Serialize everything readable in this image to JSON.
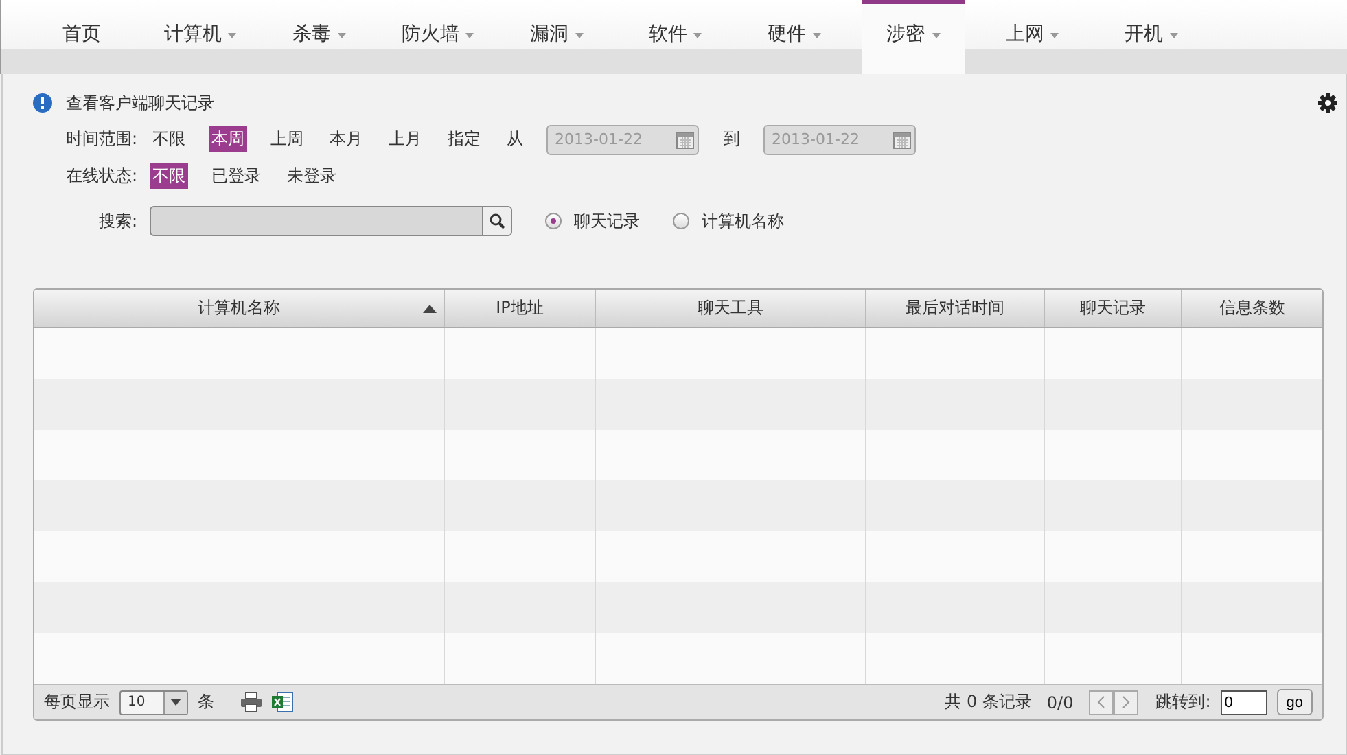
{
  "nav": {
    "tabs": [
      {
        "label": "首页",
        "caret": false,
        "selected": false
      },
      {
        "label": "计算机",
        "caret": true,
        "selected": false
      },
      {
        "label": "杀毒",
        "caret": true,
        "selected": false
      },
      {
        "label": "防火墙",
        "caret": true,
        "selected": false
      },
      {
        "label": "漏洞",
        "caret": true,
        "selected": false
      },
      {
        "label": "软件",
        "caret": true,
        "selected": false
      },
      {
        "label": "硬件",
        "caret": true,
        "selected": false
      },
      {
        "label": "涉密",
        "caret": true,
        "selected": true
      },
      {
        "label": "上网",
        "caret": true,
        "selected": false
      },
      {
        "label": "开机",
        "caret": true,
        "selected": false
      }
    ]
  },
  "title": "查看客户端聊天记录",
  "time_filter": {
    "label": "时间范围:",
    "options": [
      {
        "label": "不限",
        "selected": false
      },
      {
        "label": "本周",
        "selected": true
      },
      {
        "label": "上周",
        "selected": false
      },
      {
        "label": "本月",
        "selected": false
      },
      {
        "label": "上月",
        "selected": false
      },
      {
        "label": "指定",
        "selected": false
      }
    ],
    "from_label": "从",
    "from_value": "2013-01-22",
    "to_label": "到",
    "to_value": "2013-01-22",
    "dates_disabled": true
  },
  "status_filter": {
    "label": "在线状态:",
    "options": [
      {
        "label": "不限",
        "selected": true
      },
      {
        "label": "已登录",
        "selected": false
      },
      {
        "label": "未登录",
        "selected": false
      }
    ]
  },
  "search": {
    "label": "搜索:",
    "modes": [
      {
        "label": "聊天记录",
        "selected": true
      },
      {
        "label": "计算机名称",
        "selected": false
      }
    ]
  },
  "table": {
    "columns": [
      {
        "label": "计算机名称",
        "sorted": true
      },
      {
        "label": "IP地址",
        "sorted": false
      },
      {
        "label": "聊天工具",
        "sorted": false
      },
      {
        "label": "最后对话时间",
        "sorted": false
      },
      {
        "label": "聊天记录",
        "sorted": false
      },
      {
        "label": "信息条数",
        "sorted": false
      }
    ]
  },
  "footer": {
    "per_page_label": "每页显示",
    "per_page": "10",
    "per_page_unit": "条",
    "total_prefix": "共",
    "total": "0",
    "total_suffix": "条记录",
    "pages": "0/0",
    "jump_label": "跳转到:",
    "jump_value": "0",
    "go": "go"
  }
}
